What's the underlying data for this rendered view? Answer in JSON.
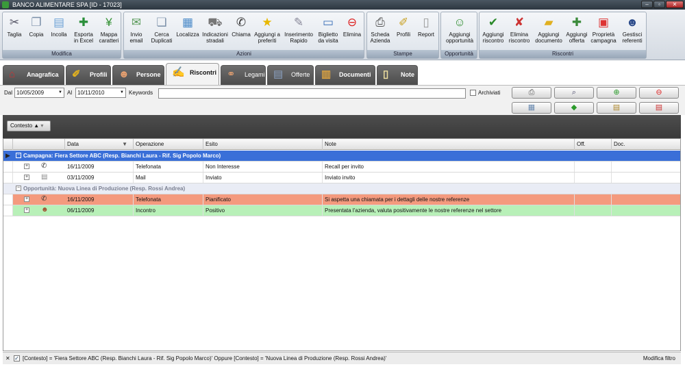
{
  "window": {
    "title": "BANCO ALIMENTARE SPA [ID - 17023]"
  },
  "ribbon": {
    "groups": {
      "modifica": "Modifica",
      "azioni": "Azioni",
      "stampe": "Stampe",
      "opportunita": "Opportunità",
      "riscontri": "Riscontri"
    },
    "buttons": {
      "taglia": "Taglia",
      "copia": "Copia",
      "incolla": "Incolla",
      "esporta": "Esporta in Excel",
      "mappa": "Mappa caratteri",
      "invio_email": "Invio email",
      "cerca_duplicati": "Cerca Duplicati",
      "localizza": "Localizza",
      "indicazioni": "Indicazioni stradali",
      "chiama": "Chiama",
      "aggiungi_preferiti": "Aggiungi a preferiti",
      "inserimento_rapido": "Inserimento Rapido",
      "biglietto": "Biglietto da visita",
      "elimina": "Elimina",
      "scheda_azienda": "Scheda Azienda",
      "profili": "Profili",
      "report": "Report",
      "aggiungi_opportunita": "Aggiungi opportunità",
      "aggiungi_riscontro": "Aggiungi riscontro",
      "elimina_riscontro": "Elimina riscontro",
      "aggiungi_documento": "Aggiungi documento",
      "aggiungi_offerta": "Aggiungi offerta",
      "proprieta_campagna": "Proprietà campagna",
      "gestisci_referenti": "Gestisci referenti"
    }
  },
  "tabs": {
    "anagrafica": "Anagrafica",
    "profili": "Profili",
    "persone": "Persone",
    "riscontri": "Riscontri",
    "legami": "Legami",
    "offerte": "Offerte",
    "documenti": "Documenti",
    "note": "Note"
  },
  "filters": {
    "dal_label": "Dal",
    "dal_value": "10/05/2009",
    "al_label": "Al",
    "al_value": "10/11/2010",
    "keywords_label": "Keywords",
    "keywords_value": "",
    "archiviati_label": "Archiviati",
    "archiviati_checked": false
  },
  "grouping": {
    "chip": "Contesto"
  },
  "grid": {
    "columns": {
      "data": "Data",
      "operazione": "Operazione",
      "esito": "Esito",
      "note": "Note",
      "off": "Off.",
      "doc": "Doc."
    },
    "group1": {
      "title": "Campagna: Fiera Settore ABC (Resp. Bianchi Laura - Rif. Sig Popolo Marco)",
      "color": "#3a6fd8"
    },
    "group1_rows": [
      {
        "data": "16/11/2009",
        "operazione": "Telefonata",
        "esito": "Non Interesse",
        "note": "Recall per invito"
      },
      {
        "data": "03/11/2009",
        "operazione": "Mail",
        "esito": "Inviato",
        "note": "Inviato invito"
      }
    ],
    "group2": {
      "title": "Opportunità: Nuova Linea di Produzione (Resp. Rossi Andrea)"
    },
    "group2_rows": [
      {
        "data": "16/11/2009",
        "operazione": "Telefonata",
        "esito": "Pianificato",
        "note": "Si aspetta una chiamata per i dettagli delle nostre referenze",
        "color": "#f49a7e"
      },
      {
        "data": "06/11/2009",
        "operazione": "Incontro",
        "esito": "Positivo",
        "note": "Presentata l'azienda, valuta positivamente le nostre referenze nel settore",
        "color": "#b8f0b8"
      }
    ]
  },
  "status": {
    "filter_text": "[Contesto] = 'Fiera Settore ABC (Resp. Bianchi Laura - Rif. Sig Popolo Marco)' Oppure [Contesto] = 'Nuova Linea di Produzione (Resp. Rossi Andrea)'",
    "modifica_filtro": "Modifica filtro"
  }
}
